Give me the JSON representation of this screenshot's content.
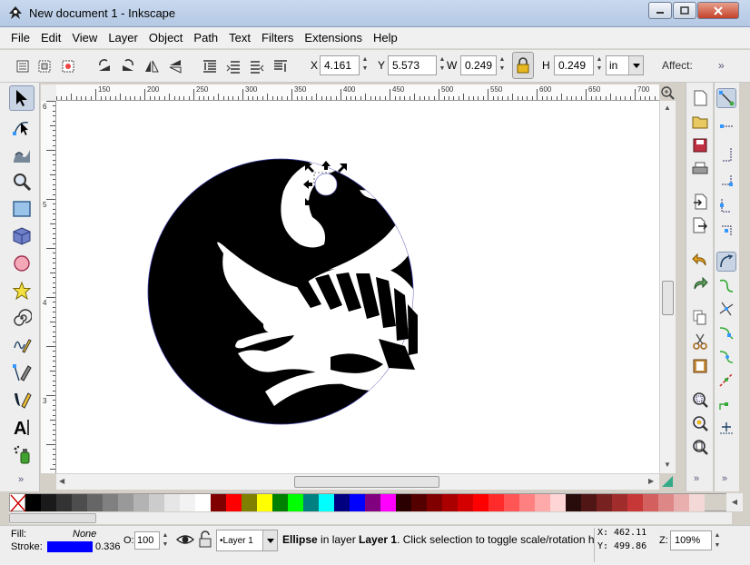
{
  "window": {
    "title": "New document 1 - Inkscape"
  },
  "menu": [
    "File",
    "Edit",
    "View",
    "Layer",
    "Object",
    "Path",
    "Text",
    "Filters",
    "Extensions",
    "Help"
  ],
  "controls": {
    "x_label": "X",
    "x_value": "4.161",
    "y_label": "Y",
    "y_value": "5.573",
    "w_label": "W",
    "w_value": "0.249",
    "h_label": "H",
    "h_value": "0.249",
    "unit": "in",
    "affect_label": "Affect:",
    "more": "»"
  },
  "ruler": {
    "h_labels": [
      "150",
      "200",
      "250",
      "300",
      "350",
      "400",
      "450",
      "500",
      "550",
      "600",
      "650",
      "700"
    ],
    "v_labels": [
      "6",
      "5",
      "4",
      "3"
    ]
  },
  "palette": [
    "#000000",
    "#1a1a1a",
    "#333333",
    "#4d4d4d",
    "#666666",
    "#808080",
    "#999999",
    "#b3b3b3",
    "#cccccc",
    "#e6e6e6",
    "#f2f2f2",
    "#ffffff",
    "#800000",
    "#ff0000",
    "#808000",
    "#ffff00",
    "#008000",
    "#00ff00",
    "#008080",
    "#00ffff",
    "#000080",
    "#0000ff",
    "#800080",
    "#ff00ff",
    "#2b0000",
    "#550000",
    "#800000",
    "#aa0000",
    "#d40000",
    "#ff0000",
    "#ff2a2a",
    "#ff5555",
    "#ff8080",
    "#ffaaaa",
    "#ffd5d5",
    "#280b0b",
    "#501616",
    "#782121",
    "#a02c2c",
    "#c83737",
    "#d35f5f",
    "#de8787",
    "#e9afaf",
    "#f4d7d7"
  ],
  "status": {
    "fill_label": "Fill:",
    "fill_value": "None",
    "stroke_label": "Stroke:",
    "stroke_color": "#0000ff",
    "stroke_width": "0.336",
    "opacity_label": "O:",
    "opacity_value": "100",
    "layer": "•Layer 1",
    "message_bold1": "Ellipse",
    "message_mid": " in layer ",
    "message_bold2": "Layer 1",
    "message_rest": ". Click selection to toggle scale/rotation ha",
    "cursor_x_label": "X:",
    "cursor_x": "462.11",
    "cursor_y_label": "Y:",
    "cursor_y": "499.86",
    "zoom_label": "Z:",
    "zoom_value": "109%"
  },
  "colors": {
    "accent": "#0000ff",
    "canvas": "#ffffff",
    "shape": "#000000"
  }
}
